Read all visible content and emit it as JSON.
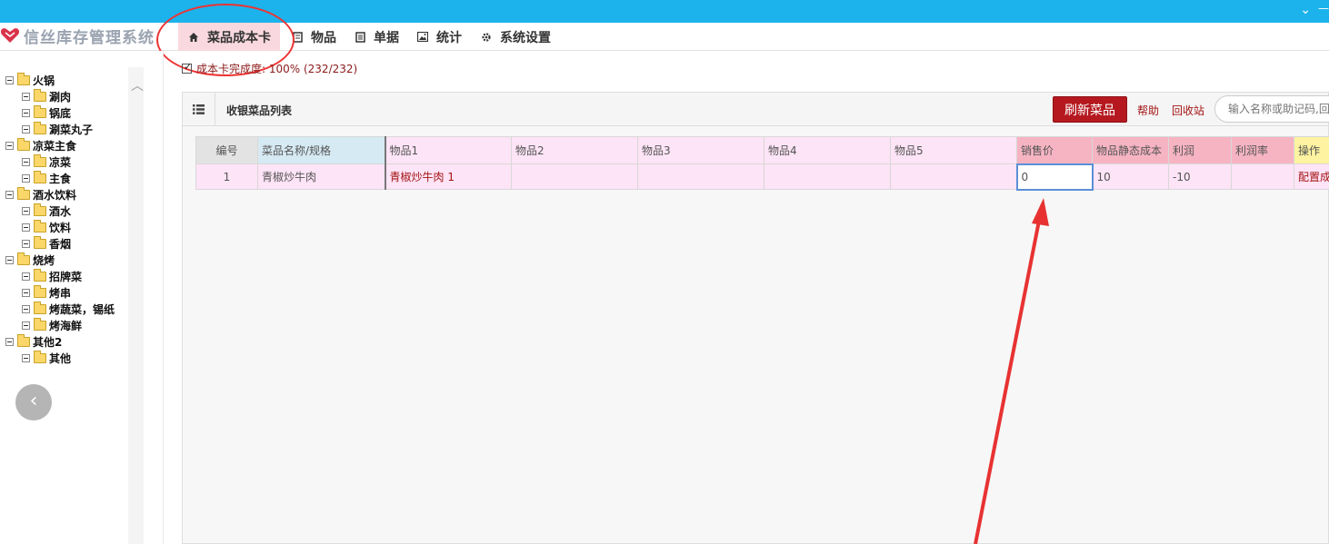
{
  "app": {
    "logo_text": "信丝库存管理系统",
    "top_chevron": "⌄",
    "top_dash": "—"
  },
  "nav": {
    "items": [
      {
        "label": "菜品成本卡",
        "icon": "home-icon"
      },
      {
        "label": "物品",
        "icon": "book-icon"
      },
      {
        "label": "单据",
        "icon": "list-icon"
      },
      {
        "label": "统计",
        "icon": "image-icon"
      },
      {
        "label": "系统设置",
        "icon": "gear-icon"
      }
    ],
    "active": "菜品成本卡"
  },
  "sidebar": {
    "tree": [
      {
        "label": "火锅",
        "children": [
          "涮肉",
          "锅底",
          "涮菜丸子"
        ]
      },
      {
        "label": "凉菜主食",
        "children": [
          "凉菜",
          "主食"
        ]
      },
      {
        "label": "酒水饮料",
        "children": [
          "酒水",
          "饮料",
          "香烟"
        ]
      },
      {
        "label": "烧烤",
        "children": [
          "招牌菜",
          "烤串",
          "烤蔬菜，锡纸",
          "烤海鲜"
        ]
      },
      {
        "label": "其他2",
        "children": [
          "其他"
        ]
      }
    ]
  },
  "main": {
    "progress_text": "成本卡完成度: 100% (232/232)",
    "panel_title": "收银菜品列表",
    "refresh_button": "刷新菜品",
    "help_link": "帮助",
    "recycle_link": "回收站",
    "search_placeholder": "输入名称或助记码,回"
  },
  "table": {
    "headers": [
      "编号",
      "菜品名称/规格",
      "物品1",
      "物品2",
      "物品3",
      "物品4",
      "物品5",
      "销售价",
      "物品静态成本",
      "利润",
      "利润率",
      "操作"
    ],
    "rows": [
      {
        "id": "1",
        "name": "青椒炒牛肉",
        "item1": "青椒炒牛肉 1",
        "item2": "",
        "item3": "",
        "item4": "",
        "item5": "",
        "price": "0",
        "cost": "10",
        "profit": "-10",
        "margin": "",
        "op": "配置成"
      }
    ]
  },
  "colors": {
    "topbar": "#1cb3ec",
    "active_tab": "#f9d9df",
    "refresh_button": "#b5191f",
    "annotation": "#e33333"
  }
}
